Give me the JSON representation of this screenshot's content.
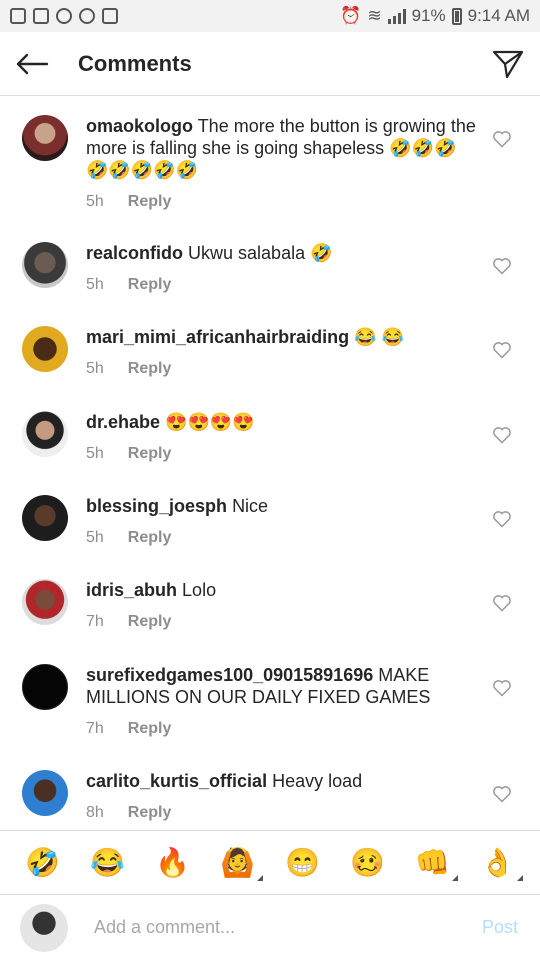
{
  "status_bar": {
    "battery": "91%",
    "time": "9:14 AM"
  },
  "header": {
    "title": "Comments"
  },
  "comments": [
    {
      "username": "omaokologo",
      "text": "The more the button is growing the more is falling she is going shapeless 🤣🤣🤣🤣🤣🤣🤣🤣",
      "time": "5h",
      "reply": "Reply"
    },
    {
      "username": "realconfido",
      "text": "Ukwu salabala 🤣",
      "time": "5h",
      "reply": "Reply"
    },
    {
      "username": "mari_mimi_africanhairbraiding",
      "text": "😂 😂",
      "time": "5h",
      "reply": "Reply"
    },
    {
      "username": "dr.ehabe",
      "text": "😍😍😍😍",
      "time": "5h",
      "reply": "Reply"
    },
    {
      "username": "blessing_joesph",
      "text": "Nice",
      "time": "5h",
      "reply": "Reply"
    },
    {
      "username": "idris_abuh",
      "text": "Lolo",
      "time": "7h",
      "reply": "Reply"
    },
    {
      "username": "surefixedgames100_09015891696",
      "text": "MAKE MILLIONS ON OUR DAILY FIXED GAMES",
      "time": "7h",
      "reply": "Reply"
    },
    {
      "username": "carlito_kurtis_official",
      "text": "Heavy load",
      "time": "8h",
      "reply": "Reply"
    }
  ],
  "emoji_bar": [
    "🤣",
    "😂",
    "🔥",
    "🙆",
    "😁",
    "🥴",
    "👊",
    "👌"
  ],
  "input": {
    "placeholder": "Add a comment...",
    "post_label": "Post"
  }
}
